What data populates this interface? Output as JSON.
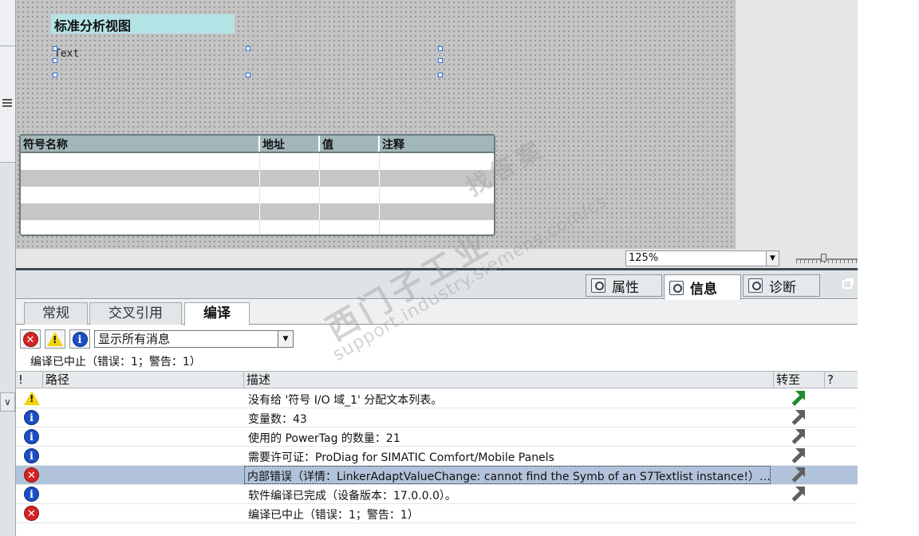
{
  "canvas": {
    "view_title": "标准分析视图",
    "text_field": "Text",
    "table": {
      "headers": [
        "符号名称",
        "地址",
        "值",
        "注释"
      ]
    }
  },
  "zoom": {
    "value": "125%"
  },
  "inspector": {
    "tabs": [
      {
        "label": "属性",
        "icon": "properties-icon"
      },
      {
        "label": "信息",
        "icon": "info-icon",
        "active": true
      },
      {
        "label": "诊断",
        "icon": "diagnostics-icon"
      }
    ],
    "subtabs": [
      {
        "label": "常规"
      },
      {
        "label": "交叉引用"
      },
      {
        "label": "编译",
        "active": true
      }
    ],
    "filter": {
      "value": "显示所有消息"
    },
    "status_line": "编译已中止（错误：1；警告：1）",
    "grid": {
      "headers": {
        "bang": "!",
        "path": "路径",
        "desc": "描述",
        "goto": "转至",
        "help": "?"
      },
      "rows": [
        {
          "type": "warning",
          "desc": "没有给 '符号 I/O 域_1' 分配文本列表。",
          "goto": "green"
        },
        {
          "type": "info",
          "desc": "变量数：43",
          "goto": "gray"
        },
        {
          "type": "info",
          "desc": "使用的 PowerTag 的数量：21",
          "goto": "gray"
        },
        {
          "type": "info",
          "desc": "需要许可证：ProDiag for SIMATIC Comfort/Mobile Panels",
          "goto": "gray"
        },
        {
          "type": "error",
          "desc": "内部错误（详情：LinkerAdaptValueChange: cannot find the Symb of an S7Textlist instance!）…",
          "goto": "gray",
          "selected": true
        },
        {
          "type": "info",
          "desc": "软件编译已完成（设备版本：17.0.0.0）。",
          "goto": "gray"
        },
        {
          "type": "error",
          "desc": "编译已中止（错误：1；警告：1）",
          "goto": "none"
        }
      ]
    }
  },
  "watermark": {
    "line1": "西门子工业",
    "line2": "support.industry.siemens.com/cs",
    "line3": "找答案"
  },
  "colors": {
    "title_bg": "#b4e3e6",
    "selected_row": "#b1c3da",
    "error": "#d42424",
    "info": "#1a4fc4",
    "warning": "#f4d20c",
    "goto_green": "#1e8a2e"
  }
}
